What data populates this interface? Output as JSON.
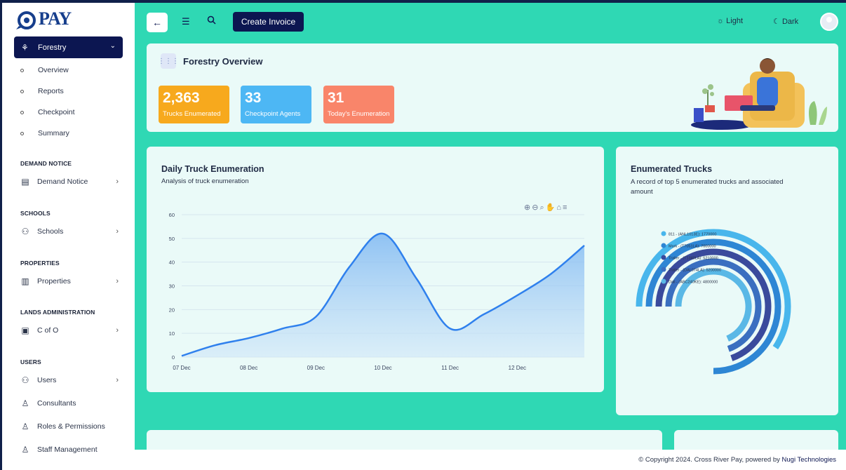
{
  "brand": {
    "logo_text": "PAY"
  },
  "sidebar": {
    "active": {
      "label": "Forestry",
      "icon": "tree-icon"
    },
    "subitems": [
      "Overview",
      "Reports",
      "Checkpoint",
      "Summary"
    ],
    "sections": [
      {
        "title": "DEMAND NOTICE",
        "item": "Demand Notice",
        "icon": "clipboard-icon"
      },
      {
        "title": "SCHOOLS",
        "item": "Schools",
        "icon": "people-icon"
      },
      {
        "title": "PROPERTIES",
        "item": "Properties",
        "icon": "building-icon"
      },
      {
        "title": "LANDS ADMINISTRATION",
        "item": "C of O",
        "icon": "certificate-icon"
      },
      {
        "title": "USERS",
        "item": "Users",
        "icon": "users-icon"
      }
    ],
    "extra_items": [
      "Consultants",
      "Roles & Permissions",
      "Staff Management"
    ]
  },
  "topbar": {
    "create_label": "Create Invoice",
    "light_label": "Light",
    "dark_label": "Dark"
  },
  "overview": {
    "title": "Forestry Overview",
    "stats": [
      {
        "value": "2,363",
        "label": "Trucks Enumerated",
        "color": "#f7a91d"
      },
      {
        "value": "33",
        "label": "Checkpoint Agents",
        "color": "#4db7f4"
      },
      {
        "value": "31",
        "label": "Today's Enumeration",
        "color": "#f9856a"
      }
    ]
  },
  "daily_chart": {
    "title": "Daily Truck Enumeration",
    "subtitle": "Analysis of truck enumeration"
  },
  "donut": {
    "title": "Enumerated Trucks",
    "subtitle": "A record of top 5 enumerated trucks and associated amount"
  },
  "chart_data": [
    {
      "type": "area",
      "title": "Daily Truck Enumeration",
      "x": [
        "07 Dec",
        "08 Dec",
        "09 Dec",
        "10 Dec",
        "11 Dec",
        "12 Dec"
      ],
      "x_points": [
        0,
        0.5,
        1,
        1.5,
        2,
        2.5,
        3,
        3.5,
        4,
        4.5,
        5,
        5.5,
        6
      ],
      "values": [
        0.5,
        5,
        8,
        12,
        17,
        38,
        52,
        33,
        12,
        18,
        26,
        35,
        47
      ],
      "ylim": [
        0,
        60
      ],
      "yticks": [
        0,
        10,
        20,
        30,
        40,
        50,
        60
      ],
      "grid": true
    },
    {
      "type": "radialBar",
      "title": "Enumerated Trucks",
      "series": [
        {
          "name": "811 - (ANL1013E): 1770000",
          "value": 1770000,
          "color": "#48b6ec"
        },
        {
          "name": "Mark - (T7051LA): 7000000",
          "value": 7000000,
          "color": "#2e86d4"
        },
        {
          "name": "Trailer - (T1340LA): 5210000",
          "value": 5210000,
          "color": "#3a4a9c"
        },
        {
          "name": "Trailer - (DAL074LA): 5200000",
          "value": 5200000,
          "color": "#3a6fc0"
        },
        {
          "name": "Dall - (ABC240KE): 4800000",
          "value": 4800000,
          "color": "#5ab8e6"
        }
      ]
    }
  ],
  "footer": {
    "text": "© Copyright 2024. Cross River Pay, powered by ",
    "brand": "Nugi Technologies"
  }
}
